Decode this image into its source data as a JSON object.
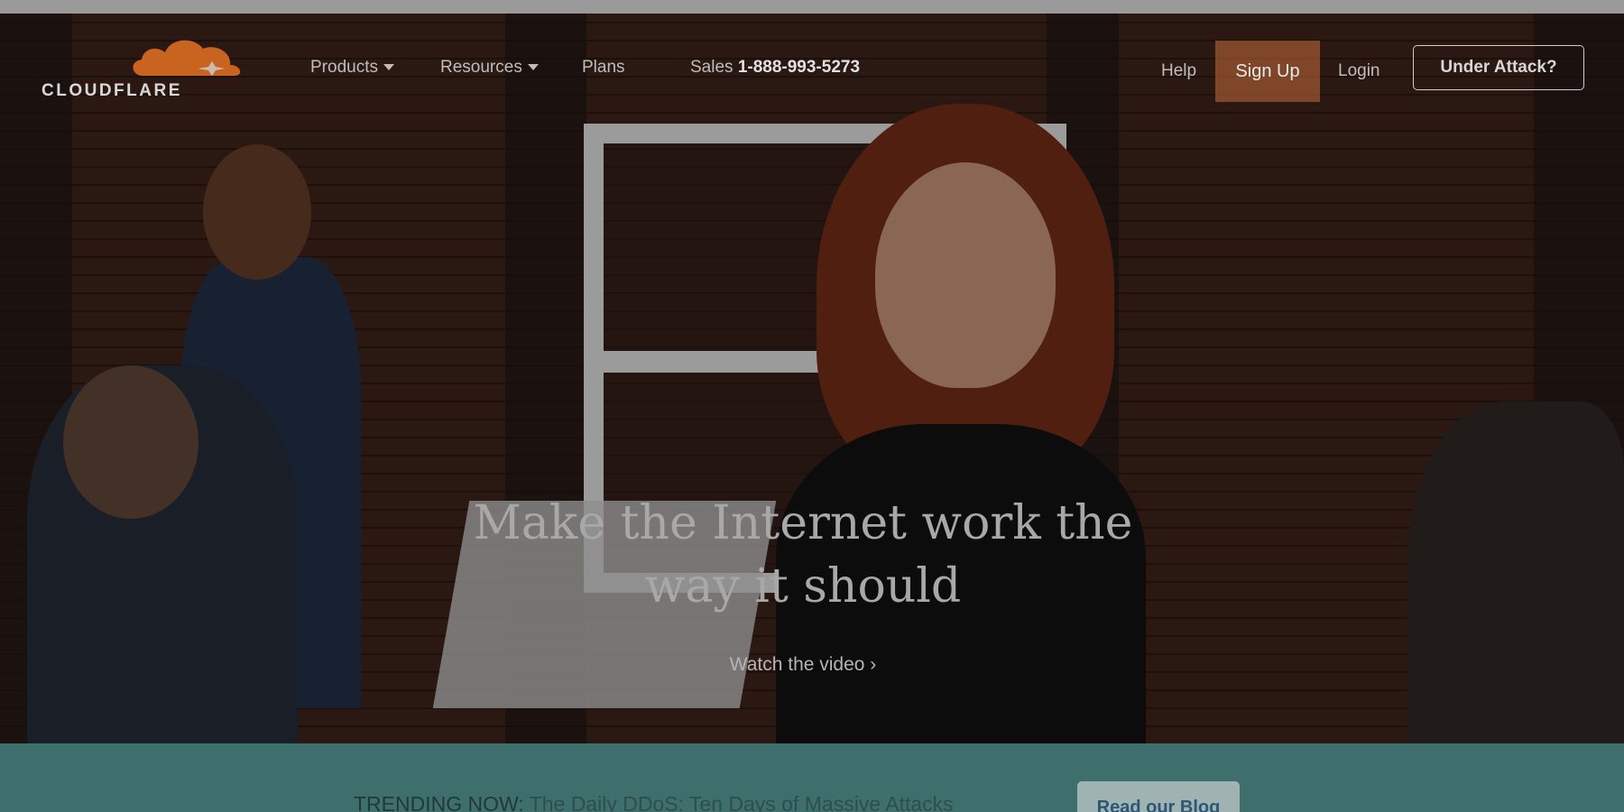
{
  "brand": {
    "name": "CLOUDFLARE",
    "accent": "#f48120"
  },
  "nav": {
    "products": "Products",
    "resources": "Resources",
    "plans": "Plans",
    "sales_prefix": "Sales",
    "sales_number": "1-888-993-5273",
    "help": "Help",
    "sign_up": "Sign Up",
    "login": "Login",
    "under_attack": "Under Attack?"
  },
  "hero": {
    "headline_line1": "Make the Internet work the",
    "headline_line2": "way it should",
    "watch_video": "Watch the video ›"
  },
  "trending": {
    "label": "TRENDING NOW:",
    "title": "The Daily DDoS: Ten Days of Massive Attacks",
    "button": "Read our Blog"
  }
}
